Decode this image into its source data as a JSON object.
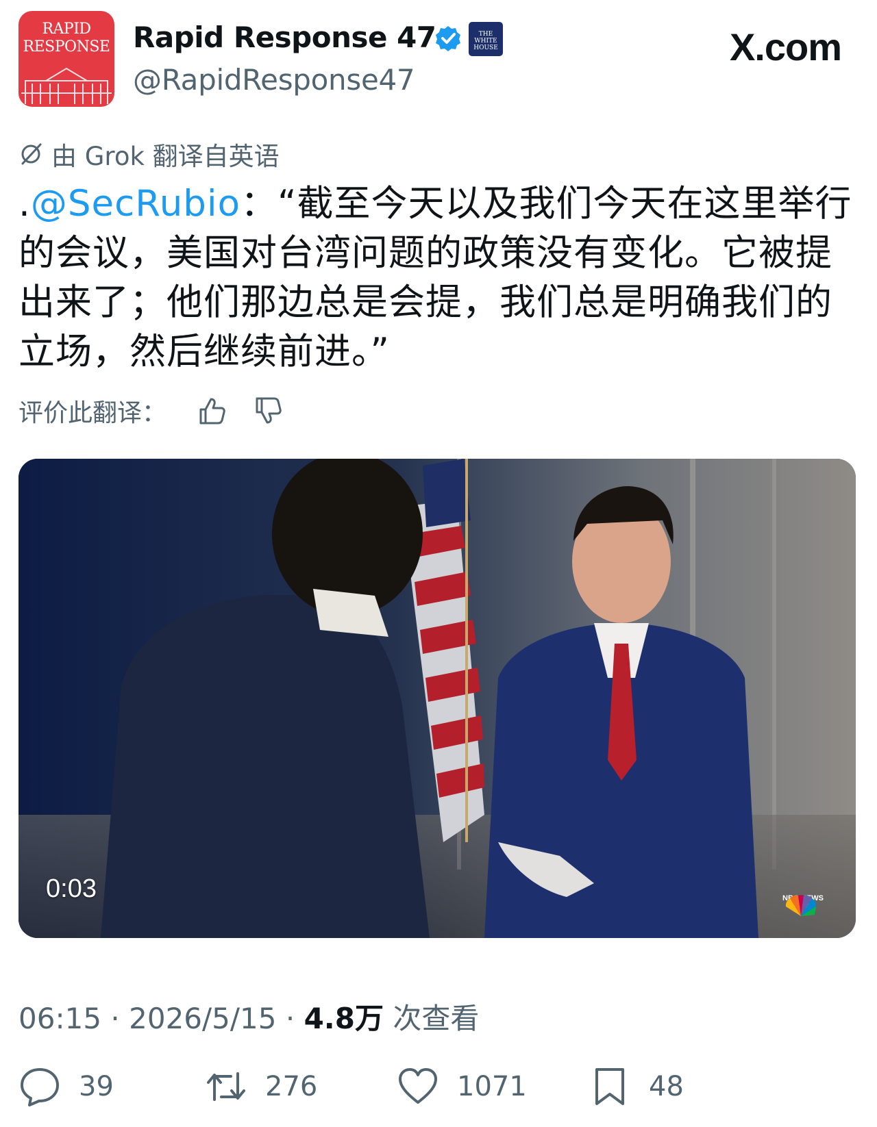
{
  "account": {
    "avatar_text": "RAPID RESPONSE",
    "display_name": "Rapid Response 47",
    "handle": "@RapidResponse47",
    "affiliation_badge": "THE WHITE HOUSE",
    "verified_icon": "verified-check-icon"
  },
  "site_logo": "X.com",
  "translation": {
    "note": "由 Grok 翻译自英语",
    "rate_label": "评价此翻译："
  },
  "tweet": {
    "prefix": ".",
    "mention": "@SecRubio",
    "text": "：“截至今天以及我们今天在这里举行的会议，美国对台湾问题的政策没有变化。它被提出来了；他们那边总是会提，我们总是明确我们的立场，然后继续前进。”"
  },
  "media": {
    "type": "video",
    "timecode": "0:03",
    "watermark": "NBC NEWS NOW"
  },
  "meta": {
    "time": "06:15",
    "separator": "·",
    "date": "2026/5/15",
    "views_count": "4.8万",
    "views_label": "次查看"
  },
  "actions": {
    "replies": "39",
    "reposts": "276",
    "likes": "1071",
    "bookmarks": "48"
  },
  "colors": {
    "link": "#1d9bf0",
    "secondary_text": "#536471",
    "avatar_red": "#e43a44",
    "verified_blue": "#1d9bf0"
  }
}
